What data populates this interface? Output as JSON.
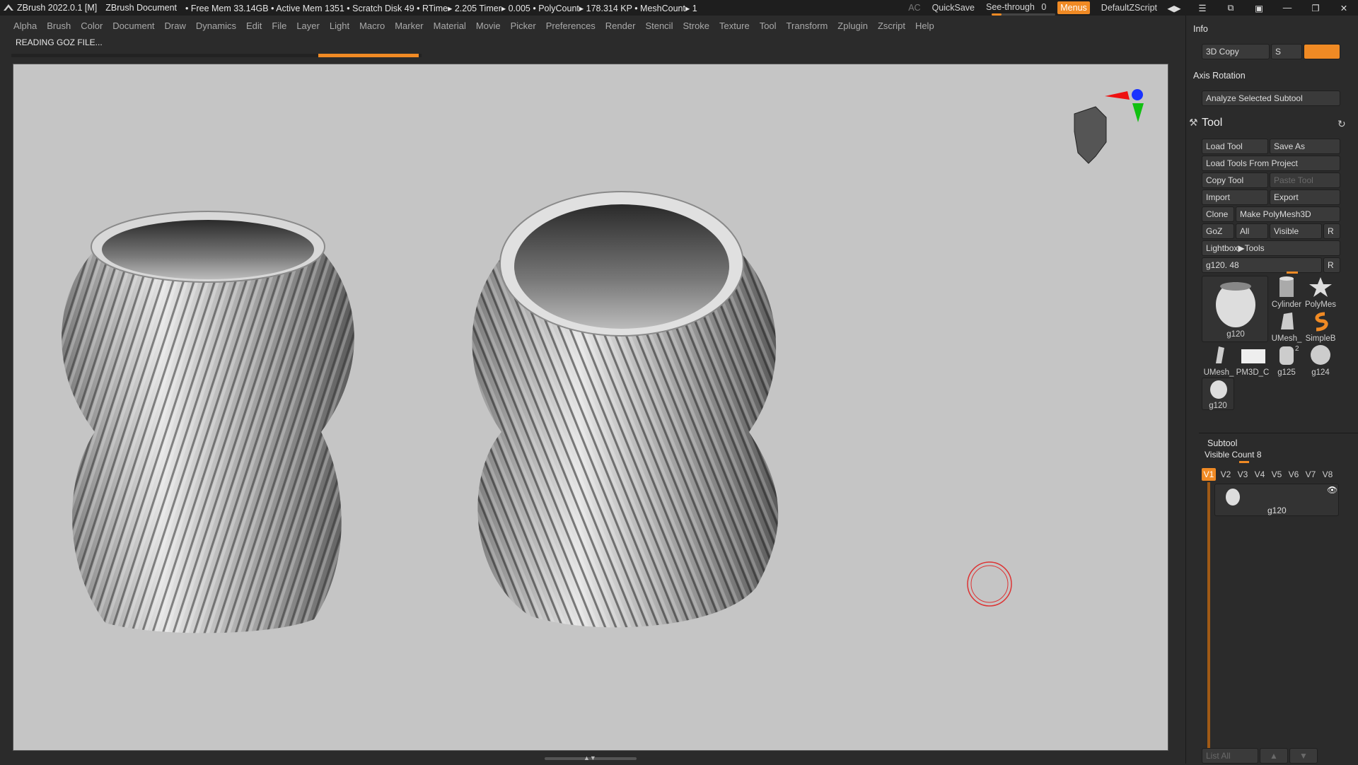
{
  "titlebar": {
    "app": "ZBrush 2022.0.1 [M]",
    "document": "ZBrush Document",
    "stats": "• Free Mem 33.14GB • Active Mem 1351 • Scratch Disk 49 •  RTime▸ 2.205 Timer▸ 0.005 • PolyCount▸ 178.314 KP  • MeshCount▸ 1",
    "ac": "AC",
    "quicksave": "QuickSave",
    "see_through_label": "See-through",
    "see_through_value": "0",
    "menus": "Menus",
    "script": "DefaultZScript"
  },
  "menubar": [
    "Alpha",
    "Brush",
    "Color",
    "Document",
    "Draw",
    "Dynamics",
    "Edit",
    "File",
    "Layer",
    "Light",
    "Macro",
    "Marker",
    "Material",
    "Movie",
    "Picker",
    "Preferences",
    "Render",
    "Stencil",
    "Stroke",
    "Texture",
    "Tool",
    "Transform",
    "Zplugin",
    "Zscript",
    "Help"
  ],
  "status": {
    "message": "READING GOZ FILE..."
  },
  "panel": {
    "info": "Info",
    "copy_3d": "3D Copy",
    "copy_s": "S",
    "axis_rotation": "Axis Rotation",
    "analyze": "Analyze Selected Subtool",
    "tool": "Tool",
    "load_tool": "Load Tool",
    "save_as": "Save As",
    "load_from_project": "Load Tools From Project",
    "copy_tool": "Copy Tool",
    "paste_tool": "Paste Tool",
    "import": "Import",
    "export": "Export",
    "clone": "Clone",
    "make_polymesh": "Make PolyMesh3D",
    "goz": "GoZ",
    "all": "All",
    "visible": "Visible",
    "r": "R",
    "lightbox": "Lightbox▶Tools",
    "tool_slider": "g120. 48",
    "thumbs": {
      "main": "g120",
      "cylinder": "Cylinder",
      "polymesh": "PolyMes",
      "umesh": "UMesh_",
      "simpleb": "SimpleB",
      "umesh2": "UMesh_",
      "pm3d": "PM3D_C",
      "g125": "g125",
      "g124": "g124",
      "g120b": "g120",
      "small_num": "2"
    },
    "subtool": "Subtool",
    "visible_count": "Visible Count 8",
    "vtabs": [
      "V1",
      "V2",
      "V3",
      "V4",
      "V5",
      "V6",
      "V7",
      "V8"
    ],
    "subtool_item": "g120",
    "list_all": "List All"
  },
  "colors": {
    "accent": "#f08a24",
    "viewport_bg": "#c5c5c5",
    "panel_bg": "#2b2b2b"
  }
}
